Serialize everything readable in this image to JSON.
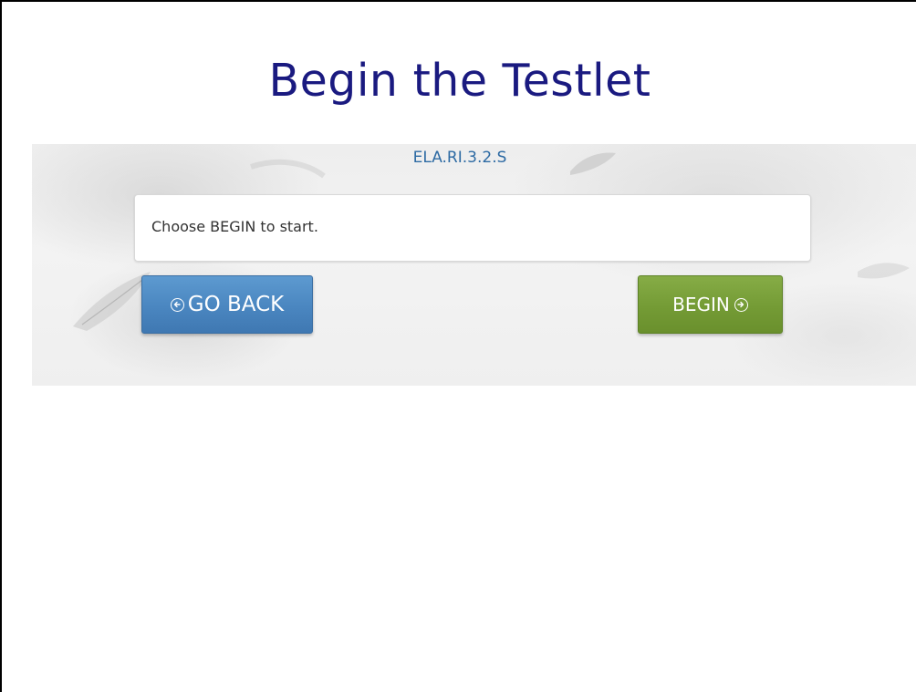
{
  "title": "Begin the Testlet",
  "testlet": {
    "code": "ELA.RI.3.2.S",
    "instruction": "Choose BEGIN to start."
  },
  "buttons": {
    "back_label": "GO BACK",
    "begin_label": "BEGIN"
  },
  "icons": {
    "back": "circle-arrow-left-icon",
    "begin": "circle-arrow-right-icon"
  },
  "colors": {
    "title": "#1a1a80",
    "code": "#2d6aa3",
    "back_button": "#4a86c0",
    "begin_button": "#749b35"
  }
}
